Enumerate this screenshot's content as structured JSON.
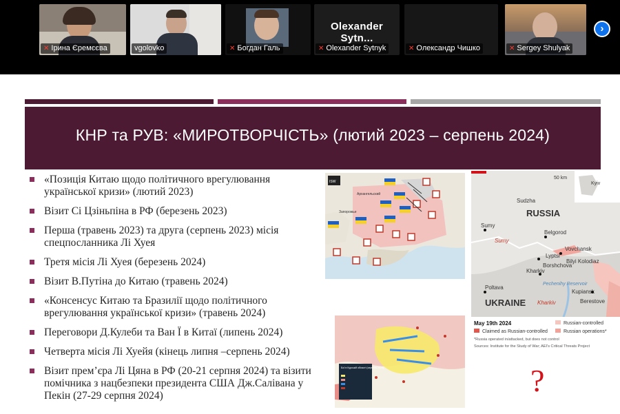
{
  "participants": [
    {
      "name": "Ірина Єремєєва",
      "muted": true
    },
    {
      "name": "vgolovko",
      "muted": false,
      "active": true
    },
    {
      "name": "Богдан Галь",
      "muted": true
    },
    {
      "name": "Olexander  Sytnyk",
      "muted": true,
      "display_name": "Olexander  Sytn..."
    },
    {
      "name": "Олександр Чишко",
      "muted": true
    },
    {
      "name": "Sergey Shulyak",
      "muted": true
    }
  ],
  "slide": {
    "title": "КНР та РУВ: «МИРОТВОРЧІСТЬ» (лютий 2023 – серпень 2024)",
    "bullets": [
      "«Позиція Китаю щодо політичного врегулювання української кризи»  (лютий 2023)",
      "Візит Сі Цзіньпіна в РФ (березень 2023)",
      "Перша (травень 2023) та друга (серпень 2023) місія спецпосланника Лі Хуея",
      "Третя місія Лі Хуея (березень 2024)",
      "Візит В.Путіна до Китаю (травень 2024)",
      "«Консенсус Китаю та Бразилії щодо політичного врегулювання української кризи» (травень 2024)",
      "Переговори Д.Кулеби та Ван Ї в Китаї (липень 2024)",
      "Четверта місія Лі Хуейя (кінець липня –серпень 2024)",
      "Візит прем’єра Лі Цяна в РФ (20-21 серпня 2024) та візити помічника з нацбезпеки президента США Дж.Салівана у Пекін  (27-29 серпня 2024)"
    ],
    "question_mark": "?",
    "colors": {
      "title_bg": "#4d1a34",
      "bullet": "#8a2f5c",
      "bar1": "#4d1a34",
      "bar2": "#8a2f5c",
      "bar3": "#a6a6a6"
    }
  },
  "map_right": {
    "scale": "50 km",
    "inset_label": "Kyiv",
    "labels": {
      "russia": "RUSSIA",
      "ukraine": "UKRAINE",
      "sudzha": "Sudzha",
      "sumy": "Sumy",
      "sumy_oblast": "Sumy",
      "belgorod": "Belgorod",
      "vovchansk": "Vovchansk",
      "lyptsi": "Lyptsi",
      "bilyi": "Bilyi Kolodiaz",
      "borshchova": "Borshchova",
      "kharkiv": "Kharkiv",
      "kharkiv_oblast": "Kharkiv",
      "reservoir": "Pechenihy Reservoir",
      "poltava": "Poltava",
      "kupiansk": "Kupiansk",
      "berestove": "Berestove"
    },
    "legend": {
      "date": "May 19th 2024",
      "items": [
        "Russian-controlled",
        "Claimed as Russian-controlled",
        "Russian operations*"
      ],
      "note": "*Russia operated in/attacked, but does not control",
      "sources": "Sources: Institute for the Study of War; AEI's Critical Threats Project"
    }
  },
  "map_left_top": {
    "label_a": "Архангельский",
    "label_b": "Запорожье"
  },
  "map_left_bottom": {
    "legend_title": "Бої в Курській області (серпень 2024)"
  }
}
